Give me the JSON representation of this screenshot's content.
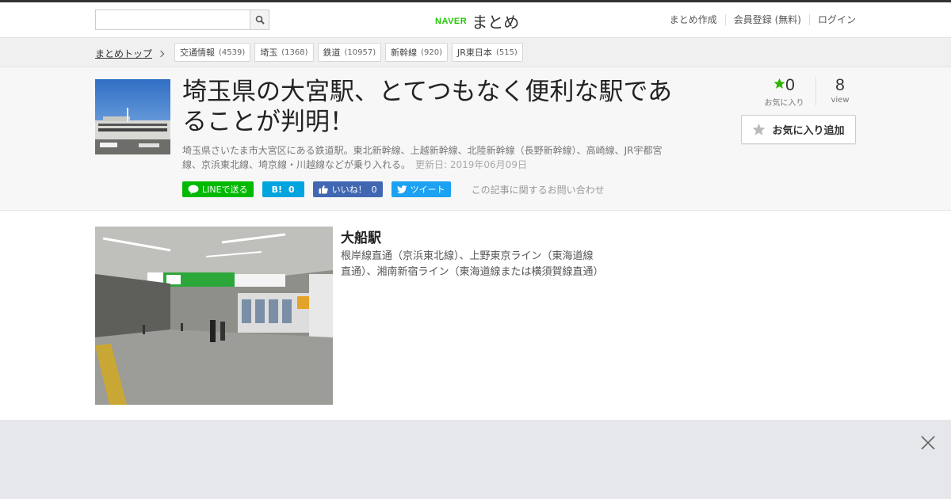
{
  "header": {
    "search_placeholder": "",
    "logo_brand": "NAVER",
    "logo_text": "まとめ",
    "links": [
      "まとめ作成",
      "会員登録 (無料)",
      "ログイン"
    ]
  },
  "tagbar": {
    "breadcrumb": "まとめトップ",
    "tags": [
      {
        "label": "交通情報",
        "count": "(4539)"
      },
      {
        "label": "埼玉",
        "count": "(1368)"
      },
      {
        "label": "鉄道",
        "count": "(10957)"
      },
      {
        "label": "新幹線",
        "count": "(920)"
      },
      {
        "label": "JR東日本",
        "count": "(515)"
      }
    ]
  },
  "article": {
    "title": "埼玉県の大宮駅、とてつもなく便利な駅であることが判明！",
    "description": "埼玉県さいたま市大宮区にある鉄道駅。東北新幹線、上越新幹線、北陸新幹線（長野新幹線）、高崎線、JR宇都宮線、京浜東北線、埼京線・川越線などが乗り入れる。",
    "updated": "更新日: 2019年06月09日",
    "favorites": "0",
    "favorites_label": "お気に入り",
    "views": "8",
    "views_label": "view",
    "fav_button": "お気に入り追加",
    "share": {
      "line": "LINEで送る",
      "hatena_count": "0",
      "like": "いいね！",
      "like_count": "0",
      "tweet": "ツイート"
    },
    "contact": "この記事に関するお問い合わせ"
  },
  "item": {
    "title": "大船駅",
    "description": "根岸線直通（京浜東北線）、上野東京ライン（東海道線直通）、湘南新宿ライン（東海道線または横須賀線直通）"
  },
  "colors": {
    "naver_green": "#1ec800",
    "line_green": "#00b900",
    "hatena_blue": "#00a4de",
    "facebook_blue": "#4267b2",
    "twitter_blue": "#1da1f2",
    "star_green": "#2db400"
  }
}
